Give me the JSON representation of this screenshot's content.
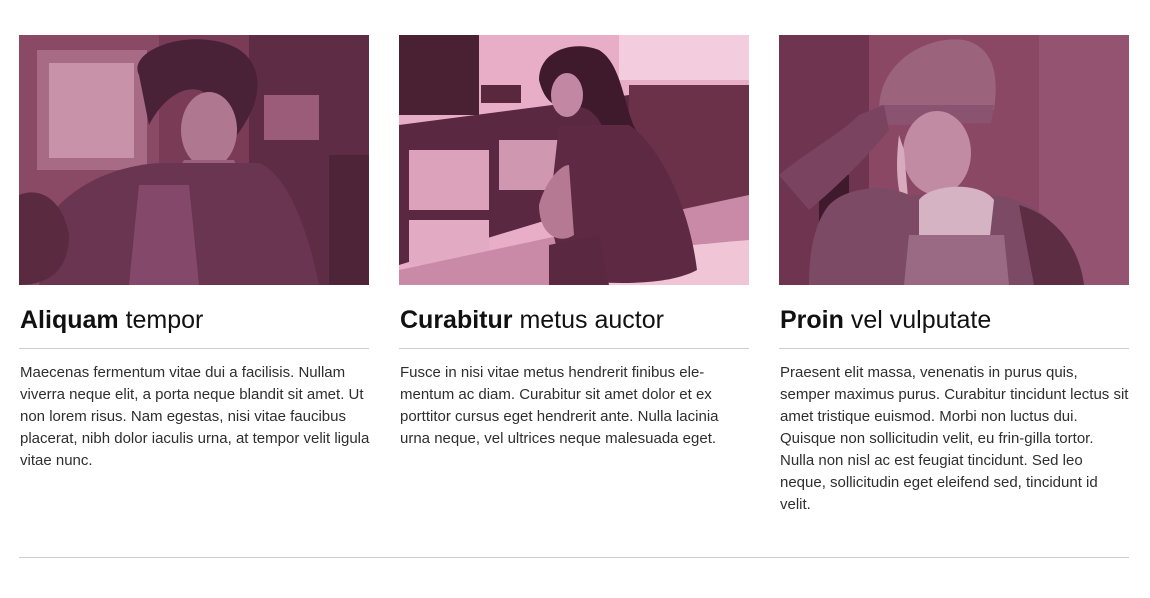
{
  "cards": [
    {
      "title_strong": "Aliquam",
      "title_rest": " tempor",
      "text": "Maecenas fermentum vitae dui a facilisis. Nullam viverra neque elit, a porta neque blandit sit amet. Ut non lorem risus. Nam egestas, nisi vitae faucibus placerat, nibh dolor iaculis urna, at tempor velit ligula vitae nunc."
    },
    {
      "title_strong": "Curabitur",
      "title_rest": " metus auctor",
      "text": "Fusce in nisi vitae metus hendrerit finibus ele-mentum ac diam. Curabitur sit amet dolor et ex porttitor cursus eget hendrerit ante. Nulla lacinia urna neque, vel ultrices neque malesuada eget."
    },
    {
      "title_strong": "Proin",
      "title_rest": " vel vulputate",
      "text": "Praesent elit massa, venenatis in purus quis, semper maximus purus. Curabitur tincidunt lectus sit amet tristique euismod. Morbi non luctus dui. Quisque non sollicitudin velit, eu frin-gilla tortor. Nulla non nisl ac est feugiat tincidunt. Sed leo neque, sollicitudin eget eleifend sed, tincidunt id velit."
    }
  ],
  "colors": {
    "photo_tint_dark": "#6e3550",
    "photo_tint_mid": "#8a4866",
    "photo_tint_light": "#eab0c8",
    "divider": "#cfcfcf"
  }
}
